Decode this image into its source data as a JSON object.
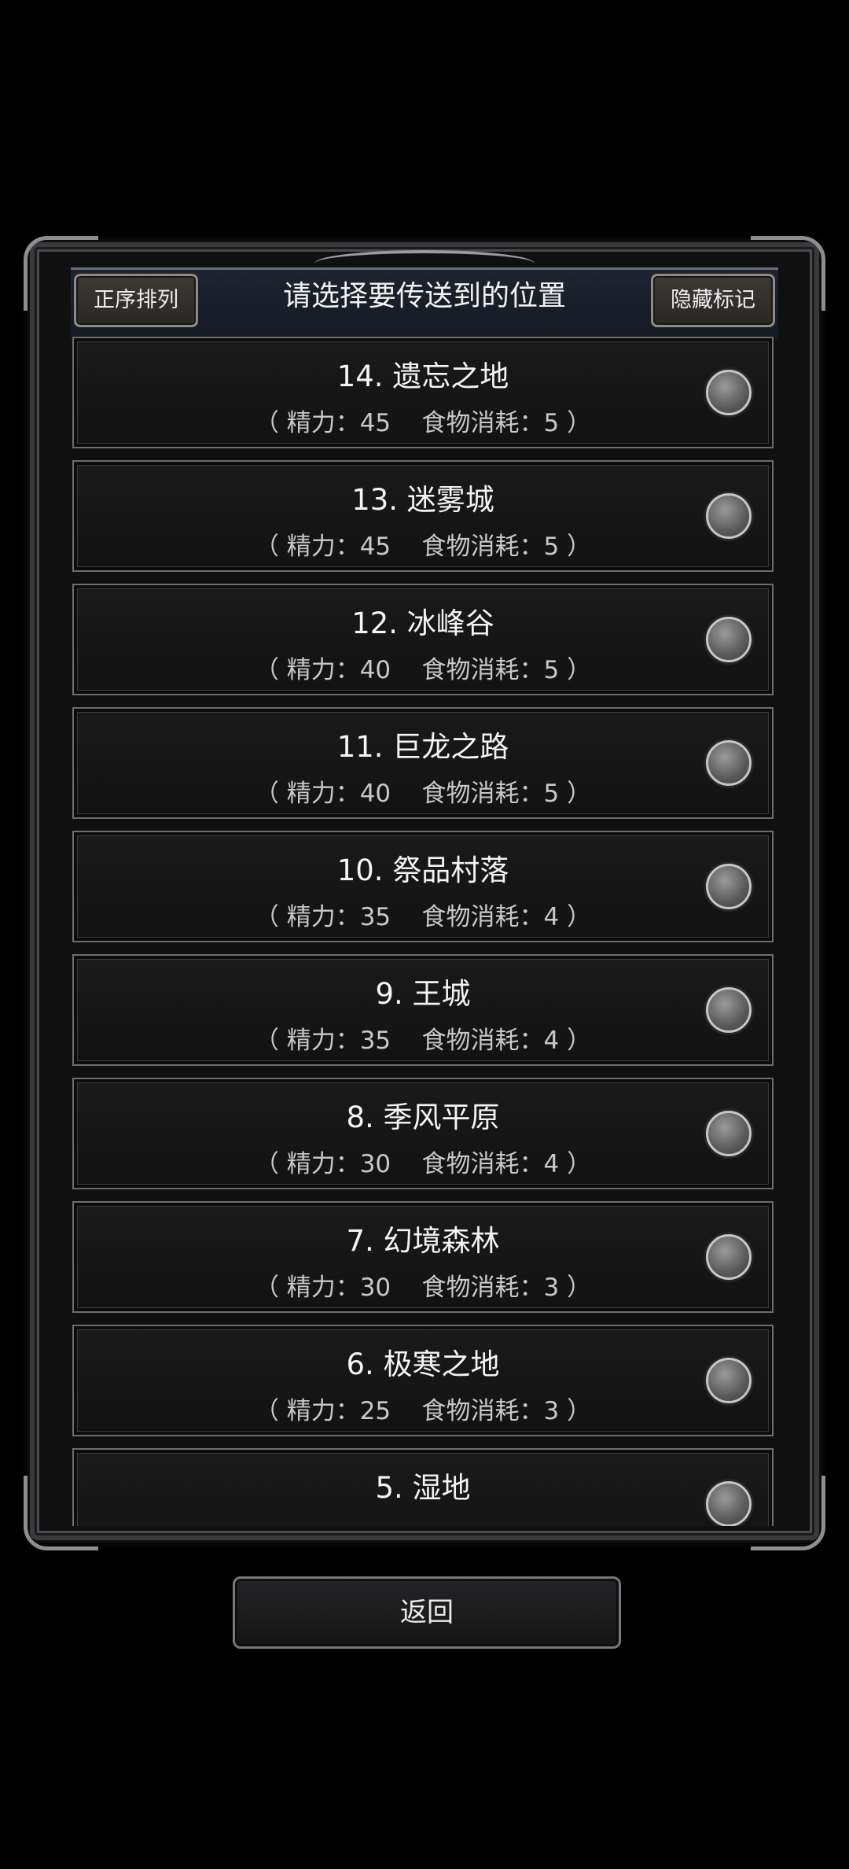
{
  "header": {
    "title": "请选择要传送到的位置",
    "sort_label": "正序排列",
    "hide_label": "隐藏标记"
  },
  "locations": [
    {
      "name": "14. 遗忘之地",
      "stats": "（ 精力：45    食物消耗：5 ）"
    },
    {
      "name": "13. 迷雾城",
      "stats": "（ 精力：45    食物消耗：5 ）"
    },
    {
      "name": "12. 冰峰谷",
      "stats": "（ 精力：40    食物消耗：5 ）"
    },
    {
      "name": "11. 巨龙之路",
      "stats": "（ 精力：40    食物消耗：5 ）"
    },
    {
      "name": "10. 祭品村落",
      "stats": "（ 精力：35    食物消耗：4 ）"
    },
    {
      "name": "9. 王城",
      "stats": "（ 精力：35    食物消耗：4 ）"
    },
    {
      "name": "8. 季风平原",
      "stats": "（ 精力：30    食物消耗：4 ）"
    },
    {
      "name": "7. 幻境森林",
      "stats": "（ 精力：30    食物消耗：3 ）"
    },
    {
      "name": "6. 极寒之地",
      "stats": "（ 精力：25    食物消耗：3 ）"
    },
    {
      "name": "5. 湿地",
      "stats": ""
    }
  ],
  "footer": {
    "back_label": "返回"
  },
  "colors": {
    "background": "#000000",
    "panel": "#101011",
    "accent": "#8f8a83"
  }
}
